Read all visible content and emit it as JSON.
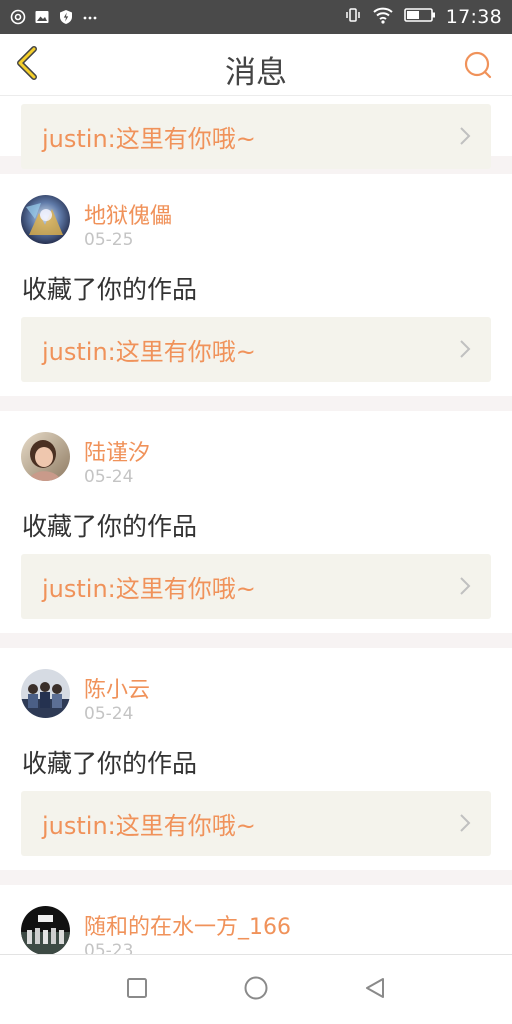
{
  "status_bar": {
    "time": "17:38",
    "left_icons": [
      "camera-circle-icon",
      "image-icon",
      "shield-bolt-icon",
      "more-dots-icon"
    ],
    "right_icons": [
      "vibrate-icon",
      "wifi-icon",
      "battery-icon"
    ]
  },
  "header": {
    "title": "消息",
    "back_icon": "chevron-left-icon",
    "search_icon": "search-icon",
    "accent_color": "#f0925a",
    "back_color": "#e6b800"
  },
  "messages": [
    {
      "name": "",
      "date": "",
      "action": "",
      "quote": "justin:这里有你哦~"
    },
    {
      "name": "地狱傀儡",
      "date": "05-25",
      "action": "收藏了你的作品",
      "quote": "justin:这里有你哦~"
    },
    {
      "name": "陆谨汐",
      "date": "05-24",
      "action": "收藏了你的作品",
      "quote": "justin:这里有你哦~"
    },
    {
      "name": "陈小云",
      "date": "05-24",
      "action": "收藏了你的作品",
      "quote": "justin:这里有你哦~"
    },
    {
      "name": "随和的在水一方_166",
      "date": "05-23",
      "action": "",
      "quote": ""
    }
  ],
  "nav_bar": {
    "icons": [
      "recent-apps-icon",
      "home-icon",
      "back-icon"
    ]
  }
}
